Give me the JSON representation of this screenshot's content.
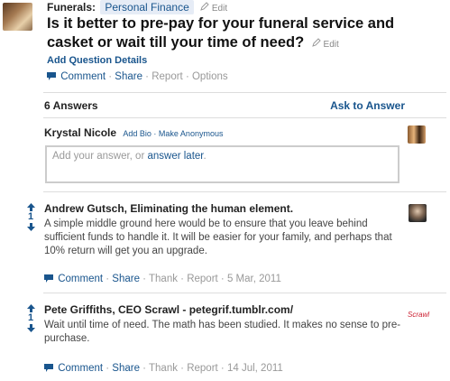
{
  "topic": {
    "label": "Funerals:",
    "pill": "Personal Finance",
    "edit": "Edit"
  },
  "question": {
    "title": "Is it better to pre-pay for your funeral service and casket or wait till your time of need?",
    "edit": "Edit",
    "add_details": "Add Question Details",
    "actions": [
      "Comment",
      "Share",
      "Report",
      "Options"
    ]
  },
  "answers_header": {
    "count_label": "6 Answers",
    "ask_label": "Ask to Answer"
  },
  "composer": {
    "user_name": "Krystal Nicole",
    "add_bio": "Add Bio",
    "make_anonymous": "Make Anonymous",
    "placeholder_prefix": "Add your answer, or ",
    "placeholder_link": "answer later",
    "placeholder_suffix": "."
  },
  "answers": [
    {
      "author": "Andrew Gutsch, Eliminating the human element.",
      "votes": "1",
      "body": "A simple middle ground here would be to ensure that you leave behind sufficient funds to handle it.  It will be easier for your family, and perhaps that 10% return will get you an upgrade.",
      "actions": [
        "Comment",
        "Share",
        "Thank",
        "Report",
        "5 Mar, 2011"
      ]
    },
    {
      "author": "Pete Griffiths, CEO Scrawl - petegrif.tumblr.com/",
      "votes": "1",
      "body": "Wait until time of need.  The math has been studied.  It makes no sense to pre-purchase.",
      "actions": [
        "Comment",
        "Share",
        "Thank",
        "Report",
        "14 Jul, 2011"
      ],
      "avatar_text": "Scrawl"
    }
  ],
  "colors": {
    "link": "#19558d",
    "pill_bg": "#e6ecf6",
    "separator": "#dddddd",
    "muted": "#999999"
  }
}
